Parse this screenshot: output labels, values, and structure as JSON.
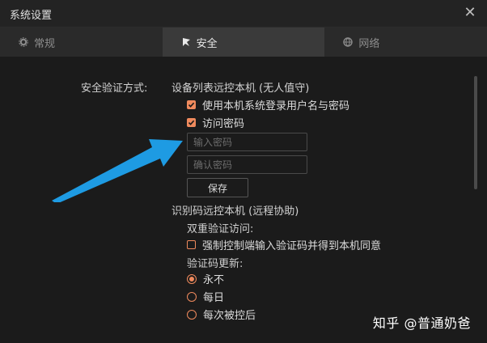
{
  "window": {
    "title": "系统设置"
  },
  "tabs": [
    {
      "label": "常规",
      "icon": "gear-icon",
      "active": false
    },
    {
      "label": "安全",
      "icon": "security-icon",
      "active": true
    },
    {
      "label": "网络",
      "icon": "globe-icon",
      "active": false
    }
  ],
  "security": {
    "label": "安全验证方式:",
    "unattended": {
      "title": "设备列表远控本机 (无人值守)",
      "use_system_login": {
        "label": "使用本机系统登录用户名与密码",
        "checked": true
      },
      "access_password": {
        "label": "访问密码",
        "checked": true
      },
      "password_input": {
        "placeholder": "输入密码",
        "value": ""
      },
      "confirm_input": {
        "placeholder": "确认密码",
        "value": ""
      },
      "save_label": "保存"
    },
    "remote_assist": {
      "title": "识别码远控本机 (远程协助)",
      "two_factor_label": "双重验证访问:",
      "force_verify": {
        "label": "强制控制端输入验证码并得到本机同意",
        "checked": false
      },
      "code_update_label": "验证码更新:",
      "options": [
        {
          "label": "永不",
          "selected": true
        },
        {
          "label": "每日",
          "selected": false
        },
        {
          "label": "每次被控后",
          "selected": false
        }
      ]
    }
  },
  "watermark": "知乎 @普通奶爸",
  "colors": {
    "accent": "#f08a5d",
    "arrow": "#1e9be3",
    "background": "#1b1b1b"
  }
}
